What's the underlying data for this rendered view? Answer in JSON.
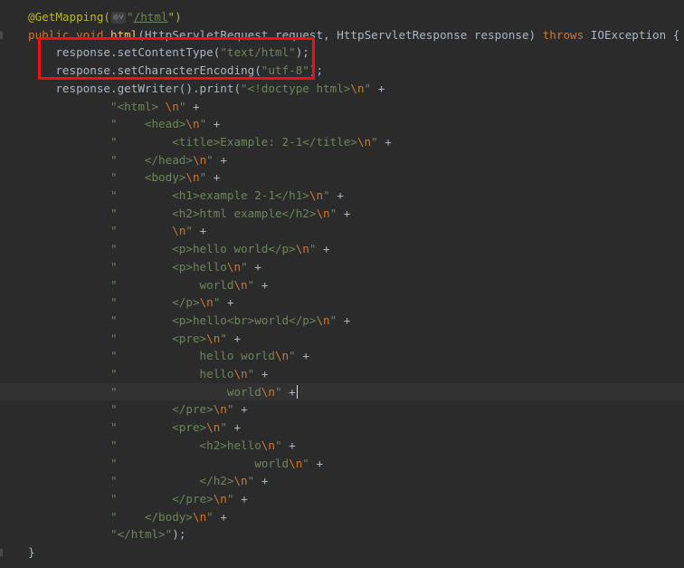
{
  "annotation": {
    "color": "#ee1111"
  },
  "colors": {
    "background": "#2b2b2b",
    "keyword": "#cc7832",
    "string": "#6a8759",
    "annotation": "#bbb529",
    "method": "#ffc66d",
    "text": "#a9b7c6"
  },
  "icons": [
    "web-endpoint-inlay-icon"
  ],
  "lines": [
    [
      {
        "t": "@GetMapping(",
        "c": "t-ann"
      },
      {
        "icon": "web-endpoint-inlay-icon"
      },
      {
        "t": "\"",
        "c": "t-str"
      },
      {
        "t": "/html",
        "c": "t-url"
      },
      {
        "t": "\")",
        "c": "t-ann"
      }
    ],
    [
      {
        "t": "public ",
        "c": "t-kw"
      },
      {
        "t": "void ",
        "c": "t-kw"
      },
      {
        "t": "html",
        "c": "t-fn"
      },
      {
        "t": "(HttpServletRequest ",
        "c": "t-plain"
      },
      {
        "t": "request",
        "c": "t-param"
      },
      {
        "t": ", HttpServletResponse response) ",
        "c": "t-plain"
      },
      {
        "t": "throws ",
        "c": "t-kw"
      },
      {
        "t": "IOException {",
        "c": "t-plain"
      }
    ],
    [
      {
        "t": "    response.setContentType(",
        "c": "t-plain"
      },
      {
        "t": "\"text/html\"",
        "c": "t-str"
      },
      {
        "t": ");",
        "c": "t-plain"
      }
    ],
    [
      {
        "t": "    response.setCharacterEncoding(",
        "c": "t-plain"
      },
      {
        "t": "\"utf-8\"",
        "c": "t-str"
      },
      {
        "t": ");",
        "c": "t-plain"
      }
    ],
    [
      {
        "t": "    response.getWriter().print(",
        "c": "t-plain"
      },
      {
        "t": "\"<!doctype html>",
        "c": "t-str"
      },
      {
        "t": "\\n",
        "c": "t-esc"
      },
      {
        "t": "\"",
        "c": "t-str"
      },
      {
        "t": " +",
        "c": "t-plain"
      }
    ],
    [
      {
        "t": "            \"<html> ",
        "c": "t-str"
      },
      {
        "t": "\\n",
        "c": "t-esc"
      },
      {
        "t": "\"",
        "c": "t-str"
      },
      {
        "t": " +",
        "c": "t-plain"
      }
    ],
    [
      {
        "t": "            \"    <head>",
        "c": "t-str"
      },
      {
        "t": "\\n",
        "c": "t-esc"
      },
      {
        "t": "\"",
        "c": "t-str"
      },
      {
        "t": " +",
        "c": "t-plain"
      }
    ],
    [
      {
        "t": "            \"        <title>Example: 2-1</title>",
        "c": "t-str"
      },
      {
        "t": "\\n",
        "c": "t-esc"
      },
      {
        "t": "\"",
        "c": "t-str"
      },
      {
        "t": " +",
        "c": "t-plain"
      }
    ],
    [
      {
        "t": "            \"    </head>",
        "c": "t-str"
      },
      {
        "t": "\\n",
        "c": "t-esc"
      },
      {
        "t": "\"",
        "c": "t-str"
      },
      {
        "t": " +",
        "c": "t-plain"
      }
    ],
    [
      {
        "t": "            \"    <body>",
        "c": "t-str"
      },
      {
        "t": "\\n",
        "c": "t-esc"
      },
      {
        "t": "\"",
        "c": "t-str"
      },
      {
        "t": " +",
        "c": "t-plain"
      }
    ],
    [
      {
        "t": "            \"        <h1>example 2-1</h1>",
        "c": "t-str"
      },
      {
        "t": "\\n",
        "c": "t-esc"
      },
      {
        "t": "\"",
        "c": "t-str"
      },
      {
        "t": " +",
        "c": "t-plain"
      }
    ],
    [
      {
        "t": "            \"        <h2>html example</h2>",
        "c": "t-str"
      },
      {
        "t": "\\n",
        "c": "t-esc"
      },
      {
        "t": "\"",
        "c": "t-str"
      },
      {
        "t": " +",
        "c": "t-plain"
      }
    ],
    [
      {
        "t": "            \"        ",
        "c": "t-str"
      },
      {
        "t": "\\n",
        "c": "t-esc"
      },
      {
        "t": "\"",
        "c": "t-str"
      },
      {
        "t": " +",
        "c": "t-plain"
      }
    ],
    [
      {
        "t": "            \"        <p>hello world</p>",
        "c": "t-str"
      },
      {
        "t": "\\n",
        "c": "t-esc"
      },
      {
        "t": "\"",
        "c": "t-str"
      },
      {
        "t": " +",
        "c": "t-plain"
      }
    ],
    [
      {
        "t": "            \"        <p>hello",
        "c": "t-str"
      },
      {
        "t": "\\n",
        "c": "t-esc"
      },
      {
        "t": "\"",
        "c": "t-str"
      },
      {
        "t": " +",
        "c": "t-plain"
      }
    ],
    [
      {
        "t": "            \"            world",
        "c": "t-str"
      },
      {
        "t": "\\n",
        "c": "t-esc"
      },
      {
        "t": "\"",
        "c": "t-str"
      },
      {
        "t": " +",
        "c": "t-plain"
      }
    ],
    [
      {
        "t": "            \"        </p>",
        "c": "t-str"
      },
      {
        "t": "\\n",
        "c": "t-esc"
      },
      {
        "t": "\"",
        "c": "t-str"
      },
      {
        "t": " +",
        "c": "t-plain"
      }
    ],
    [
      {
        "t": "            \"        <p>hello<br>world</p>",
        "c": "t-str"
      },
      {
        "t": "\\n",
        "c": "t-esc"
      },
      {
        "t": "\"",
        "c": "t-str"
      },
      {
        "t": " +",
        "c": "t-plain"
      }
    ],
    [
      {
        "t": "            \"        <pre>",
        "c": "t-str"
      },
      {
        "t": "\\n",
        "c": "t-esc"
      },
      {
        "t": "\"",
        "c": "t-str"
      },
      {
        "t": " +",
        "c": "t-plain"
      }
    ],
    [
      {
        "t": "            \"            hello world",
        "c": "t-str"
      },
      {
        "t": "\\n",
        "c": "t-esc"
      },
      {
        "t": "\"",
        "c": "t-str"
      },
      {
        "t": " +",
        "c": "t-plain"
      }
    ],
    [
      {
        "t": "            \"            hello",
        "c": "t-str"
      },
      {
        "t": "\\n",
        "c": "t-esc"
      },
      {
        "t": "\"",
        "c": "t-str"
      },
      {
        "t": " +",
        "c": "t-plain"
      }
    ],
    [
      {
        "t": "            \"                world",
        "c": "t-str"
      },
      {
        "t": "\\n",
        "c": "t-esc"
      },
      {
        "t": "\"",
        "c": "t-str"
      },
      {
        "t": " +",
        "c": "t-plain"
      },
      {
        "caret": true
      }
    ],
    [
      {
        "t": "            \"        </pre>",
        "c": "t-str"
      },
      {
        "t": "\\n",
        "c": "t-esc"
      },
      {
        "t": "\"",
        "c": "t-str"
      },
      {
        "t": " +",
        "c": "t-plain"
      }
    ],
    [
      {
        "t": "            \"        <pre>",
        "c": "t-str"
      },
      {
        "t": "\\n",
        "c": "t-esc"
      },
      {
        "t": "\"",
        "c": "t-str"
      },
      {
        "t": " +",
        "c": "t-plain"
      }
    ],
    [
      {
        "t": "            \"            <h2>hello",
        "c": "t-str"
      },
      {
        "t": "\\n",
        "c": "t-esc"
      },
      {
        "t": "\"",
        "c": "t-str"
      },
      {
        "t": " +",
        "c": "t-plain"
      }
    ],
    [
      {
        "t": "            \"                    world",
        "c": "t-str"
      },
      {
        "t": "\\n",
        "c": "t-esc"
      },
      {
        "t": "\"",
        "c": "t-str"
      },
      {
        "t": " +",
        "c": "t-plain"
      }
    ],
    [
      {
        "t": "            \"            </h2>",
        "c": "t-str"
      },
      {
        "t": "\\n",
        "c": "t-esc"
      },
      {
        "t": "\"",
        "c": "t-str"
      },
      {
        "t": " +",
        "c": "t-plain"
      }
    ],
    [
      {
        "t": "            \"        </pre>",
        "c": "t-str"
      },
      {
        "t": "\\n",
        "c": "t-esc"
      },
      {
        "t": "\"",
        "c": "t-str"
      },
      {
        "t": " +",
        "c": "t-plain"
      }
    ],
    [
      {
        "t": "            \"    </body>",
        "c": "t-str"
      },
      {
        "t": "\\n",
        "c": "t-esc"
      },
      {
        "t": "\"",
        "c": "t-str"
      },
      {
        "t": " +",
        "c": "t-plain"
      }
    ],
    [
      {
        "t": "            \"</html>\"",
        "c": "t-str"
      },
      {
        "t": ");",
        "c": "t-plain"
      }
    ],
    [
      {
        "t": "}",
        "c": "t-plain"
      }
    ]
  ],
  "current_line": 21
}
